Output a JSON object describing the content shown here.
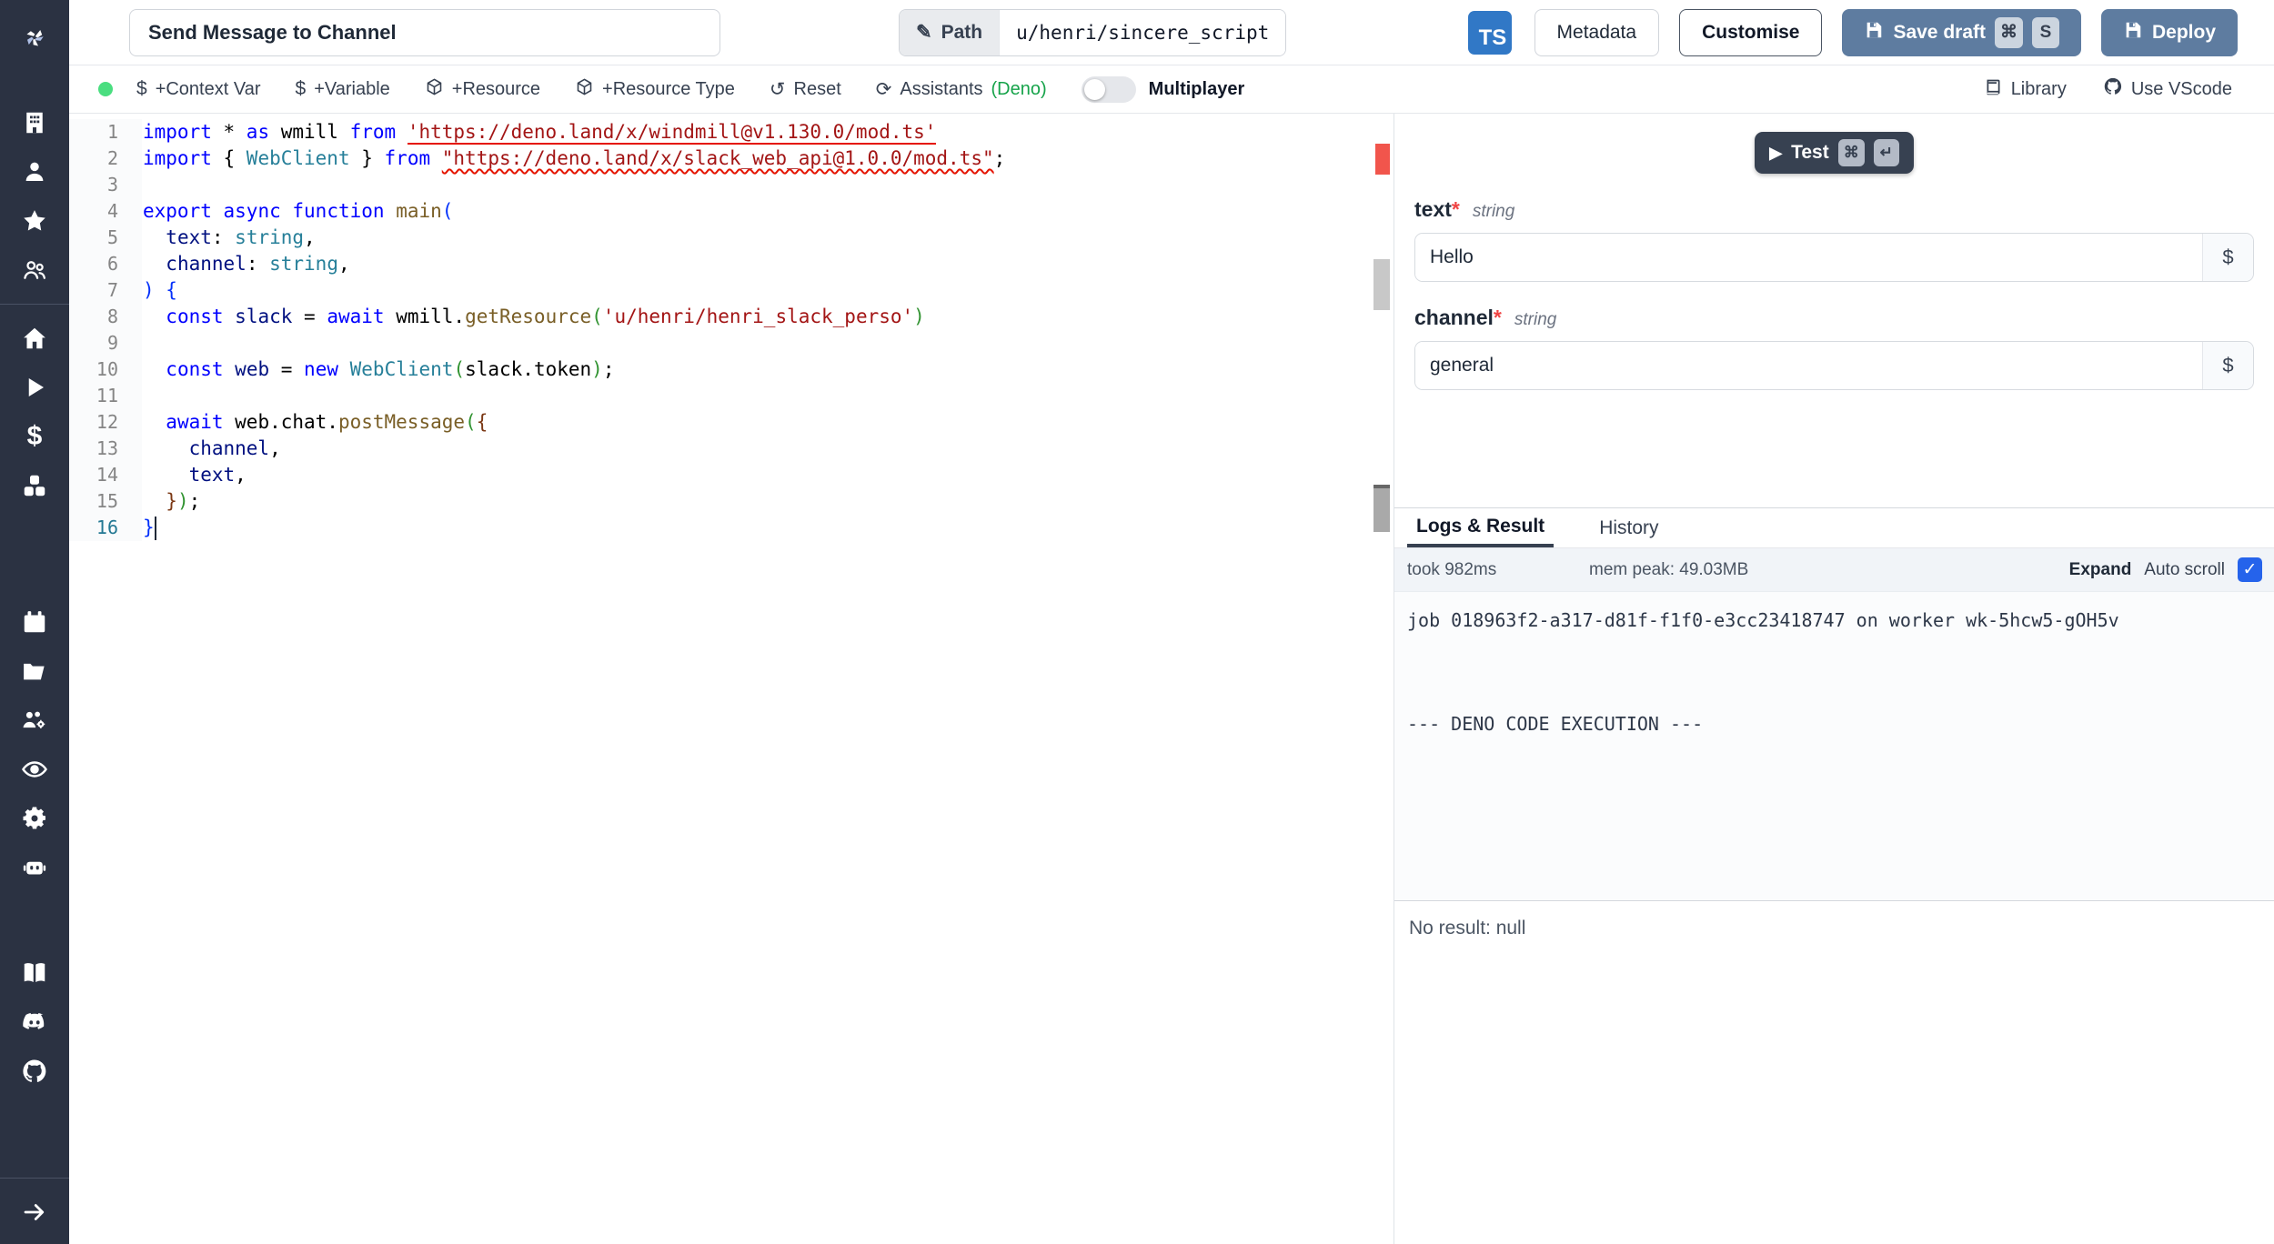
{
  "topbar": {
    "title_value": "Send Message to Channel",
    "path_label": "Path",
    "path_value": "u/henri/sincere_script",
    "lang_badge": "TS",
    "metadata_label": "Metadata",
    "customise_label": "Customise",
    "save_draft_label": "Save draft",
    "save_kbd_1": "⌘",
    "save_kbd_2": "S",
    "deploy_label": "Deploy"
  },
  "toolbar": {
    "context_var": "+Context Var",
    "variable": "+Variable",
    "resource": "+Resource",
    "resource_type": "+Resource Type",
    "reset": "Reset",
    "assistants": "Assistants",
    "assistants_lang": "(Deno)",
    "multiplayer": "Multiplayer",
    "library": "Library",
    "vscode": "Use VScode"
  },
  "colors": {
    "accent_blue": "#3178c6",
    "button_blue": "#5e7ca0",
    "status_green": "#4ade80",
    "deno_green": "#16a34a",
    "error_red": "#e51400",
    "checkbox_blue": "#2563eb"
  },
  "code": {
    "active_line": 16,
    "lines": [
      [
        [
          "kw",
          "import"
        ],
        [
          "pl",
          " * "
        ],
        [
          "kw",
          "as"
        ],
        [
          "pl",
          " wmill "
        ],
        [
          "kw",
          "from"
        ],
        [
          "pl",
          " "
        ],
        [
          "strU",
          "'https://deno.land/x/windmill@v1.130.0/mod.ts'"
        ]
      ],
      [
        [
          "kw",
          "import"
        ],
        [
          "pl",
          " { "
        ],
        [
          "type",
          "WebClient"
        ],
        [
          "pl",
          " } "
        ],
        [
          "kw",
          "from"
        ],
        [
          "pl",
          " "
        ],
        [
          "strW",
          "\"https://deno.land/x/slack_web_api@1.0.0/mod.ts\""
        ],
        [
          "pl",
          ";"
        ]
      ],
      [],
      [
        [
          "kw",
          "export"
        ],
        [
          "pl",
          " "
        ],
        [
          "kw",
          "async"
        ],
        [
          "pl",
          " "
        ],
        [
          "kw",
          "function"
        ],
        [
          "pl",
          " "
        ],
        [
          "fn",
          "main"
        ],
        [
          "br1",
          "("
        ]
      ],
      [
        [
          "pl",
          "  "
        ],
        [
          "id",
          "text"
        ],
        [
          "pl",
          ": "
        ],
        [
          "type",
          "string"
        ],
        [
          "pl",
          ","
        ]
      ],
      [
        [
          "pl",
          "  "
        ],
        [
          "id",
          "channel"
        ],
        [
          "pl",
          ": "
        ],
        [
          "type",
          "string"
        ],
        [
          "pl",
          ","
        ]
      ],
      [
        [
          "br1",
          ") {"
        ]
      ],
      [
        [
          "pl",
          "  "
        ],
        [
          "kw",
          "const"
        ],
        [
          "pl",
          " "
        ],
        [
          "id",
          "slack"
        ],
        [
          "pl",
          " = "
        ],
        [
          "kw",
          "await"
        ],
        [
          "pl",
          " wmill."
        ],
        [
          "fn",
          "getResource"
        ],
        [
          "br2",
          "("
        ],
        [
          "str",
          "'u/henri/henri_slack_perso'"
        ],
        [
          "br2",
          ")"
        ]
      ],
      [],
      [
        [
          "pl",
          "  "
        ],
        [
          "kw",
          "const"
        ],
        [
          "pl",
          " "
        ],
        [
          "id",
          "web"
        ],
        [
          "pl",
          " = "
        ],
        [
          "kw",
          "new"
        ],
        [
          "pl",
          " "
        ],
        [
          "type",
          "WebClient"
        ],
        [
          "br2",
          "("
        ],
        [
          "pl",
          "slack.token"
        ],
        [
          "br2",
          ")"
        ],
        [
          "pl",
          ";"
        ]
      ],
      [],
      [
        [
          "pl",
          "  "
        ],
        [
          "kw",
          "await"
        ],
        [
          "pl",
          " web.chat."
        ],
        [
          "fn",
          "postMessage"
        ],
        [
          "br2",
          "("
        ],
        [
          "br3",
          "{"
        ]
      ],
      [
        [
          "pl",
          "    "
        ],
        [
          "id",
          "channel"
        ],
        [
          "pl",
          ","
        ]
      ],
      [
        [
          "pl",
          "    "
        ],
        [
          "id",
          "text"
        ],
        [
          "pl",
          ","
        ]
      ],
      [
        [
          "pl",
          "  "
        ],
        [
          "br3",
          "}"
        ],
        [
          "br2",
          ")"
        ],
        [
          "pl",
          ";"
        ]
      ],
      [
        [
          "br1",
          "}"
        ],
        [
          "cursor",
          ""
        ]
      ]
    ]
  },
  "run": {
    "test_label": "Test",
    "test_kbd_1": "⌘",
    "test_kbd_2": "↵"
  },
  "args": [
    {
      "name": "text",
      "required": "*",
      "type": "string",
      "value": "Hello"
    },
    {
      "name": "channel",
      "required": "*",
      "type": "string",
      "value": "general"
    }
  ],
  "results": {
    "tab_logs": "Logs & Result",
    "tab_history": "History",
    "took": "took 982ms",
    "mem": "mem peak: 49.03MB",
    "expand_label": "Expand",
    "autoscroll_label": "Auto scroll",
    "checkbox_check": "✓",
    "log_text": "job 018963f2-a317-d81f-f1f0-e3cc23418747 on worker wk-5hcw5-gOH5v\n\n\n--- DENO CODE EXECUTION ---",
    "no_result": "No result: null"
  }
}
